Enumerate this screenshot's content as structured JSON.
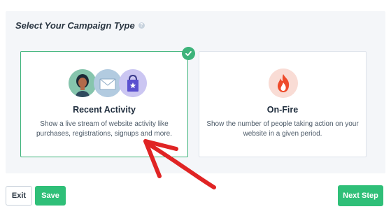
{
  "header": {
    "title": "Select Your Campaign Type",
    "help_icon": "?"
  },
  "cards": [
    {
      "title": "Recent Activity",
      "description": "Show a live stream of website activity like purchases, registrations, signups and more.",
      "selected": true,
      "icon": "avatars-group-icon"
    },
    {
      "title": "On-Fire",
      "description": "Show the number of people taking action on your website in a given period.",
      "selected": false,
      "icon": "fire-icon"
    }
  ],
  "footer": {
    "exit_label": "Exit",
    "save_label": "Save",
    "next_label": "Next Step"
  },
  "colors": {
    "accent_green": "#2fbf78",
    "selected_border": "#3db37a",
    "annotation_red": "#e02424",
    "panel_bg": "#f4f6f9"
  }
}
